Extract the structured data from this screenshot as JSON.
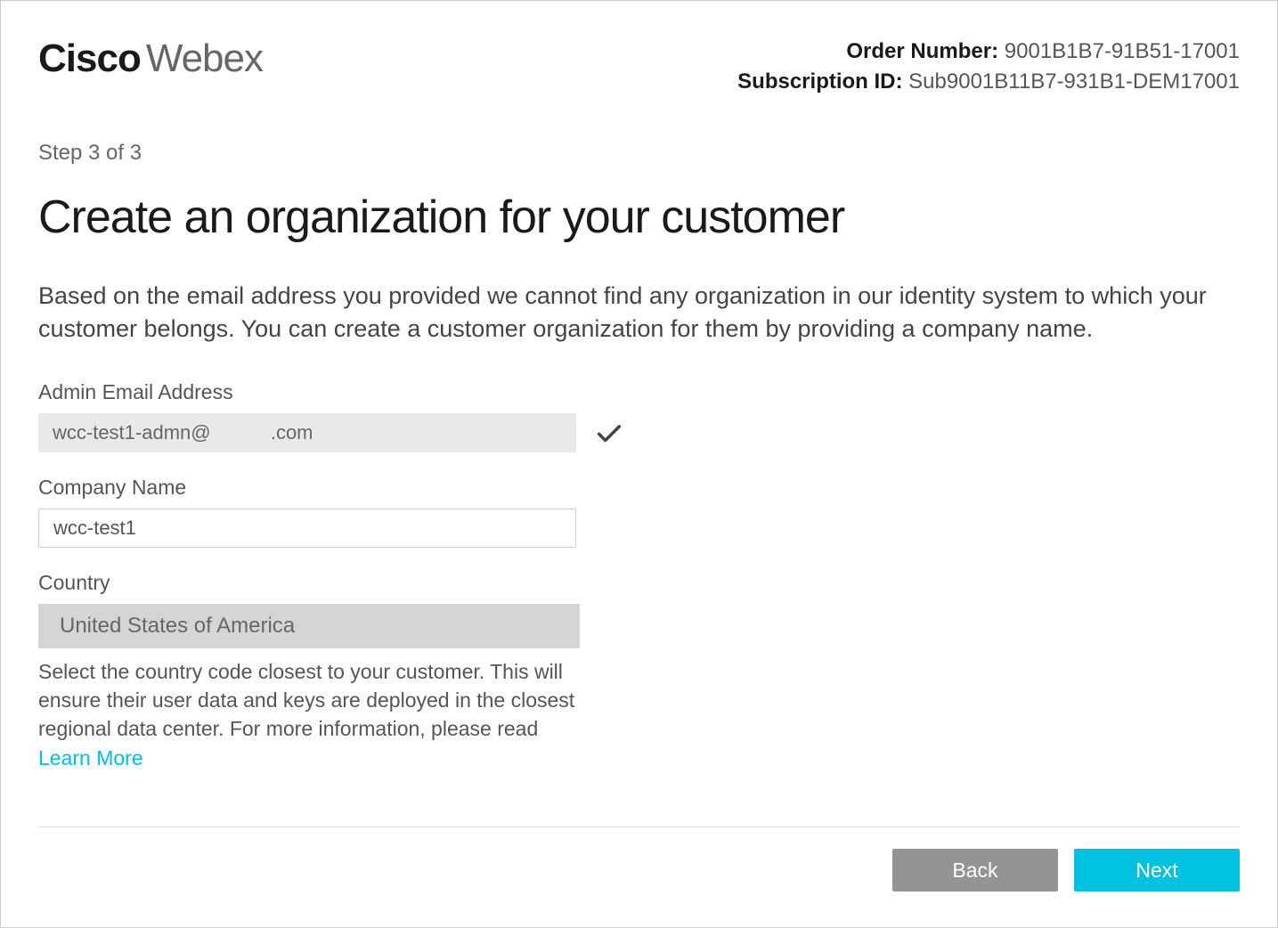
{
  "header": {
    "logo_cisco": "Cisco",
    "logo_webex": "Webex",
    "order_number_label": "Order Number:",
    "order_number_value": "9001B1B7-91B51-17001",
    "subscription_id_label": "Subscription ID:",
    "subscription_id_value": "Sub9001B11B7-931B1-DEM17001"
  },
  "step": "Step 3 of 3",
  "title": "Create an organization for your customer",
  "description": "Based on the email address you provided we cannot find any organization in our identity system to which your customer belongs. You can create a customer organization for them by providing a company name.",
  "form": {
    "email_label": "Admin Email Address",
    "email_value": "wcc-test1-admn@           .com",
    "company_label": "Company Name",
    "company_value": "wcc-test1",
    "country_label": "Country",
    "country_value": "United States of America",
    "country_help_prefix": "Select the country code closest to your customer. This will ensure their user data and keys are deployed in the closest regional data center. For more information, please read ",
    "learn_more": "Learn More"
  },
  "buttons": {
    "back": "Back",
    "next": "Next"
  }
}
